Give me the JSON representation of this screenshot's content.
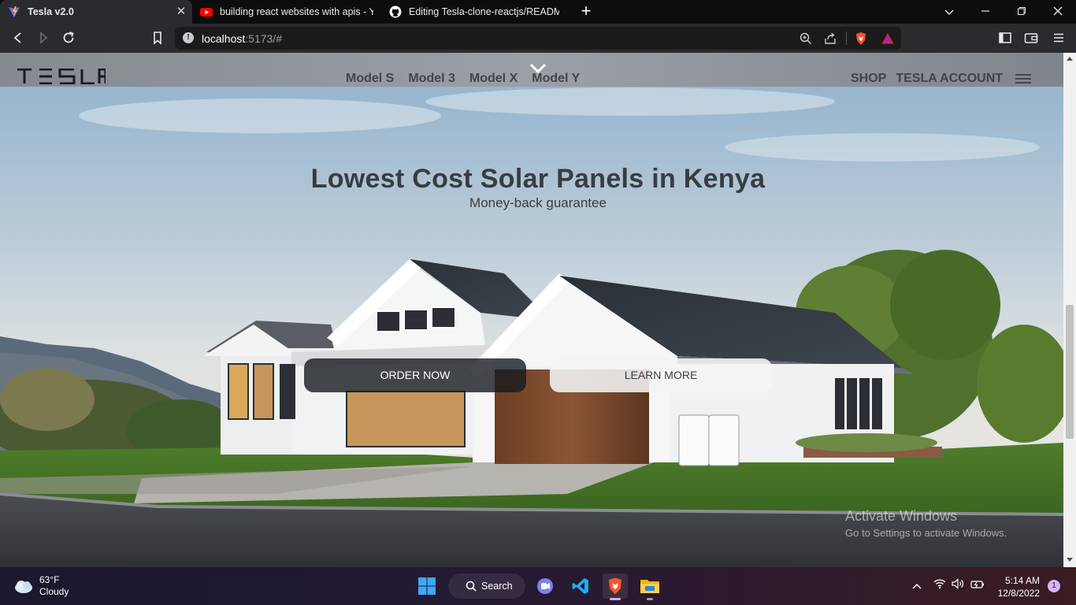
{
  "browser": {
    "tabs": [
      {
        "title": "Tesla v2.0",
        "active": true
      },
      {
        "title": "building react websites with apis - YouTube",
        "active": false
      },
      {
        "title": "Editing Tesla-clone-reactjs/README.md",
        "active": false
      }
    ],
    "url_host": "localhost",
    "url_rest": ":5173/#"
  },
  "site": {
    "logo_text": "TESLA",
    "nav": [
      "Model S",
      "Model 3",
      "Model X",
      "Model Y"
    ],
    "nav_right": [
      "SHOP",
      "TESLA ACCOUNT"
    ]
  },
  "hero": {
    "title": "Lowest Cost Solar Panels in Kenya",
    "subtitle": "Money-back guarantee",
    "primary_button": "ORDER NOW",
    "secondary_button": "LEARN MORE"
  },
  "watermark": {
    "line1": "Activate Windows",
    "line2": "Go to Settings to activate Windows."
  },
  "taskbar": {
    "weather_temp": "63°F",
    "weather_desc": "Cloudy",
    "search_label": "Search",
    "time": "5:14 AM",
    "date": "12/8/2022",
    "notification_count": "1"
  },
  "colors": {
    "accent_brave": "#fb542b",
    "text_dark": "#393c41"
  }
}
